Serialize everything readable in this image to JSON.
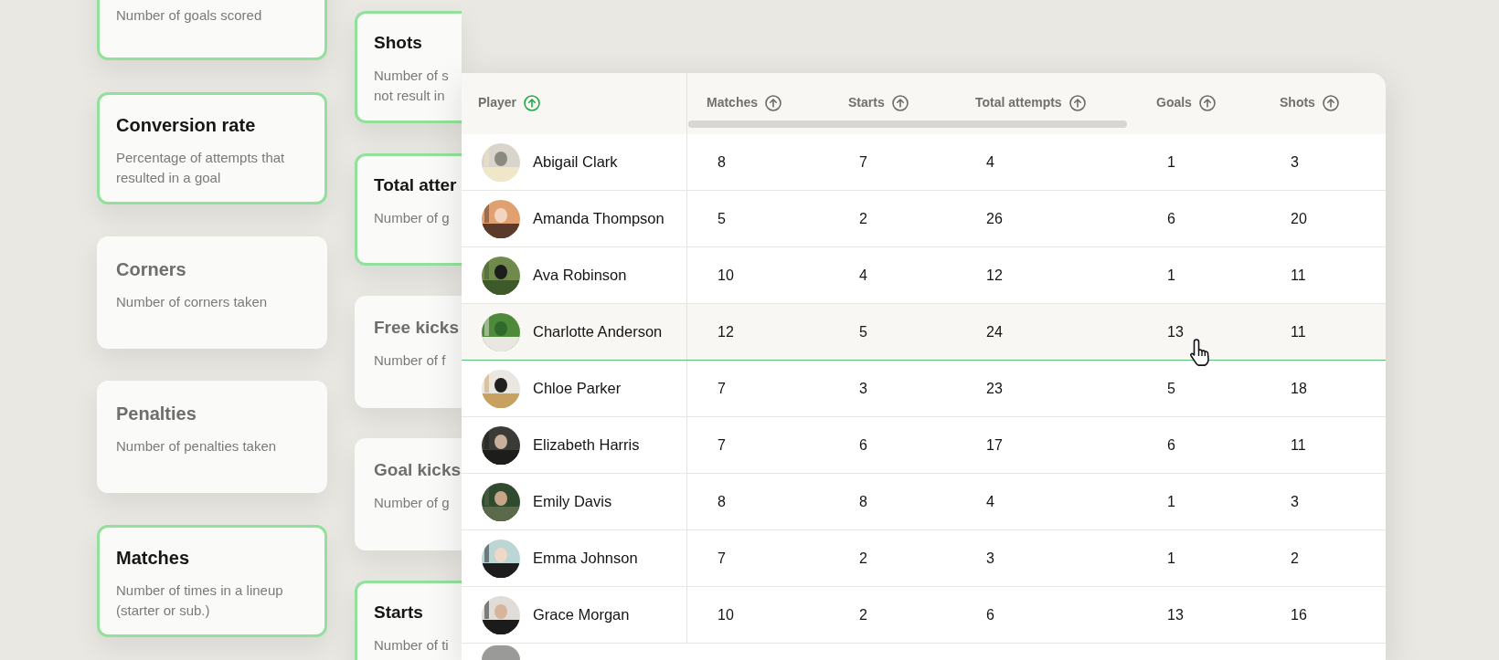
{
  "left_cards": [
    {
      "description": "Number of goals scored",
      "selected": true
    },
    {
      "title": "Conversion rate",
      "description": "Percentage of attempts that resulted in a goal",
      "selected": true
    },
    {
      "title": "Corners",
      "description": "Number of corners taken",
      "selected": false
    },
    {
      "title": "Penalties",
      "description": "Number of penalties taken",
      "selected": false
    },
    {
      "title": "Matches",
      "description": "Number of times in a lineup (starter or sub.)",
      "selected": true
    }
  ],
  "middle_cards": [
    {
      "title": "Shots",
      "description_lines": [
        "Number of s",
        "not result in"
      ],
      "selected": true
    },
    {
      "title": "Total atter",
      "description_lines": [
        "Number of g"
      ],
      "selected": true
    },
    {
      "title": "Free kicks",
      "description_lines": [
        "Number of f"
      ],
      "selected": false
    },
    {
      "title": "Goal kicks",
      "description_lines": [
        "Number of g"
      ],
      "selected": false
    },
    {
      "title": "Starts",
      "description_lines": [
        "Number of ti"
      ],
      "selected": true
    }
  ],
  "table": {
    "columns": [
      {
        "label": "Player",
        "sorted": true
      },
      {
        "label": "Matches",
        "sorted": false
      },
      {
        "label": "Starts",
        "sorted": false
      },
      {
        "label": "Total attempts",
        "sorted": false
      },
      {
        "label": "Goals",
        "sorted": false
      },
      {
        "label": "Shots",
        "sorted": false
      }
    ],
    "rows": [
      {
        "cells": [
          "Abigail Clark",
          "8",
          "7",
          "4",
          "1",
          "3"
        ],
        "selected": false
      },
      {
        "cells": [
          "Amanda Thompson",
          "5",
          "2",
          "26",
          "6",
          "20"
        ],
        "selected": false
      },
      {
        "cells": [
          "Ava Robinson",
          "10",
          "4",
          "12",
          "1",
          "11"
        ],
        "selected": false
      },
      {
        "cells": [
          "Charlotte Anderson",
          "12",
          "5",
          "24",
          "13",
          "11"
        ],
        "selected": true
      },
      {
        "cells": [
          "Chloe Parker",
          "7",
          "3",
          "23",
          "5",
          "18"
        ],
        "selected": false
      },
      {
        "cells": [
          "Elizabeth Harris",
          "7",
          "6",
          "17",
          "6",
          "11"
        ],
        "selected": false
      },
      {
        "cells": [
          "Emily Davis",
          "8",
          "8",
          "4",
          "1",
          "3"
        ],
        "selected": false
      },
      {
        "cells": [
          "Emma Johnson",
          "7",
          "2",
          "3",
          "1",
          "2"
        ],
        "selected": false
      },
      {
        "cells": [
          "Grace Morgan",
          "10",
          "2",
          "6",
          "13",
          "16"
        ],
        "selected": false
      }
    ]
  }
}
